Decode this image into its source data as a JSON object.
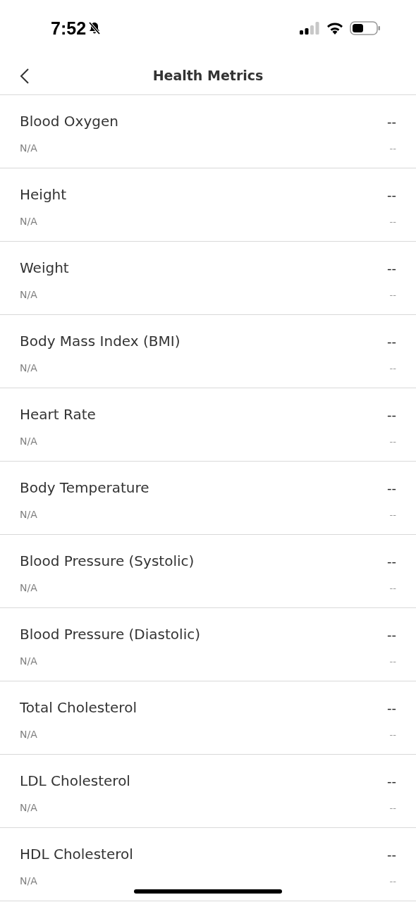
{
  "status_bar": {
    "time": "7:52"
  },
  "header": {
    "title": "Health Metrics"
  },
  "metrics": [
    {
      "name": "Blood Oxygen",
      "value": "--",
      "detail": "N/A",
      "detail_value": "--"
    },
    {
      "name": "Height",
      "value": "--",
      "detail": "N/A",
      "detail_value": "--"
    },
    {
      "name": "Weight",
      "value": "--",
      "detail": "N/A",
      "detail_value": "--"
    },
    {
      "name": "Body Mass Index (BMI)",
      "value": "--",
      "detail": "N/A",
      "detail_value": "--"
    },
    {
      "name": "Heart Rate",
      "value": "--",
      "detail": "N/A",
      "detail_value": "--"
    },
    {
      "name": "Body Temperature",
      "value": "--",
      "detail": "N/A",
      "detail_value": "--"
    },
    {
      "name": "Blood Pressure (Systolic)",
      "value": "--",
      "detail": "N/A",
      "detail_value": "--"
    },
    {
      "name": "Blood Pressure (Diastolic)",
      "value": "--",
      "detail": "N/A",
      "detail_value": "--"
    },
    {
      "name": "Total Cholesterol",
      "value": "--",
      "detail": "N/A",
      "detail_value": "--"
    },
    {
      "name": "LDL Cholesterol",
      "value": "--",
      "detail": "N/A",
      "detail_value": "--"
    },
    {
      "name": "HDL Cholesterol",
      "value": "--",
      "detail": "N/A",
      "detail_value": "--"
    }
  ]
}
